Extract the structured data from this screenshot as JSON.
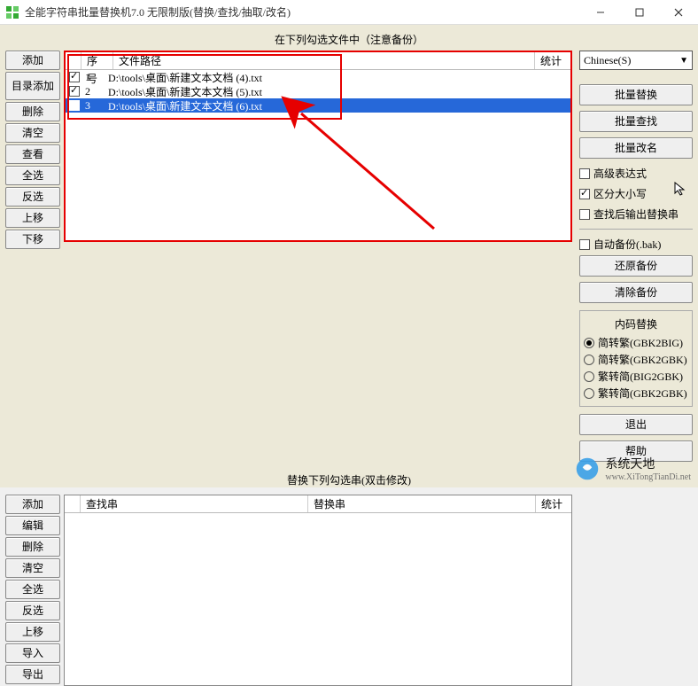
{
  "window": {
    "title": "全能字符串批量替换机7.0 无限制版(替换/查找/抽取/改名)"
  },
  "section1_label": "在下列勾选文件中（注意备份）",
  "section2_label": "替换下列勾选串(双击修改)",
  "left_buttons_upper": [
    "添加",
    "目录添加",
    "删除",
    "清空",
    "查看",
    "全选",
    "反选",
    "上移",
    "下移"
  ],
  "left_buttons_lower": [
    "添加",
    "编辑",
    "删除",
    "清空",
    "全选",
    "反选",
    "上移",
    "导入",
    "导出"
  ],
  "file_table": {
    "headers": {
      "index": "序号",
      "path": "文件路径",
      "stat": "统计"
    },
    "col_widths": {
      "chk": 18,
      "index": 36,
      "path_flex": 1,
      "stat": 40
    },
    "rows": [
      {
        "checked": true,
        "n": "1",
        "path": "D:\\tools\\桌面\\新建文本文档 (4).txt",
        "selected": false
      },
      {
        "checked": true,
        "n": "2",
        "path": "D:\\tools\\桌面\\新建文本文档 (5).txt",
        "selected": false
      },
      {
        "checked": true,
        "n": "3",
        "path": "D:\\tools\\桌面\\新建文本文档 (6).txt",
        "selected": true
      }
    ]
  },
  "replace_table": {
    "headers": {
      "search": "查找串",
      "replace": "替换串",
      "stat": "统计"
    }
  },
  "right": {
    "lang": "Chinese(S)",
    "batch_replace": "批量替换",
    "batch_search": "批量查找",
    "batch_rename": "批量改名",
    "adv_expr": "高级表达式",
    "case_sensitive": "区分大小写",
    "output_after_search": "查找后输出替换串",
    "auto_backup": "自动备份(.bak)",
    "restore_backup": "还原备份",
    "clear_backup": "清除备份",
    "encoding_group": "内码替换",
    "enc_opts": [
      "简转繁(GBK2BIG)",
      "简转繁(GBK2GBK)",
      "繁转简(BIG2GBK)",
      "繁转简(GBK2GBK)"
    ],
    "exit": "退出",
    "help": "帮助"
  },
  "watermark": {
    "brand": "系统天地",
    "url": "www.XiTongTianDi.net"
  }
}
